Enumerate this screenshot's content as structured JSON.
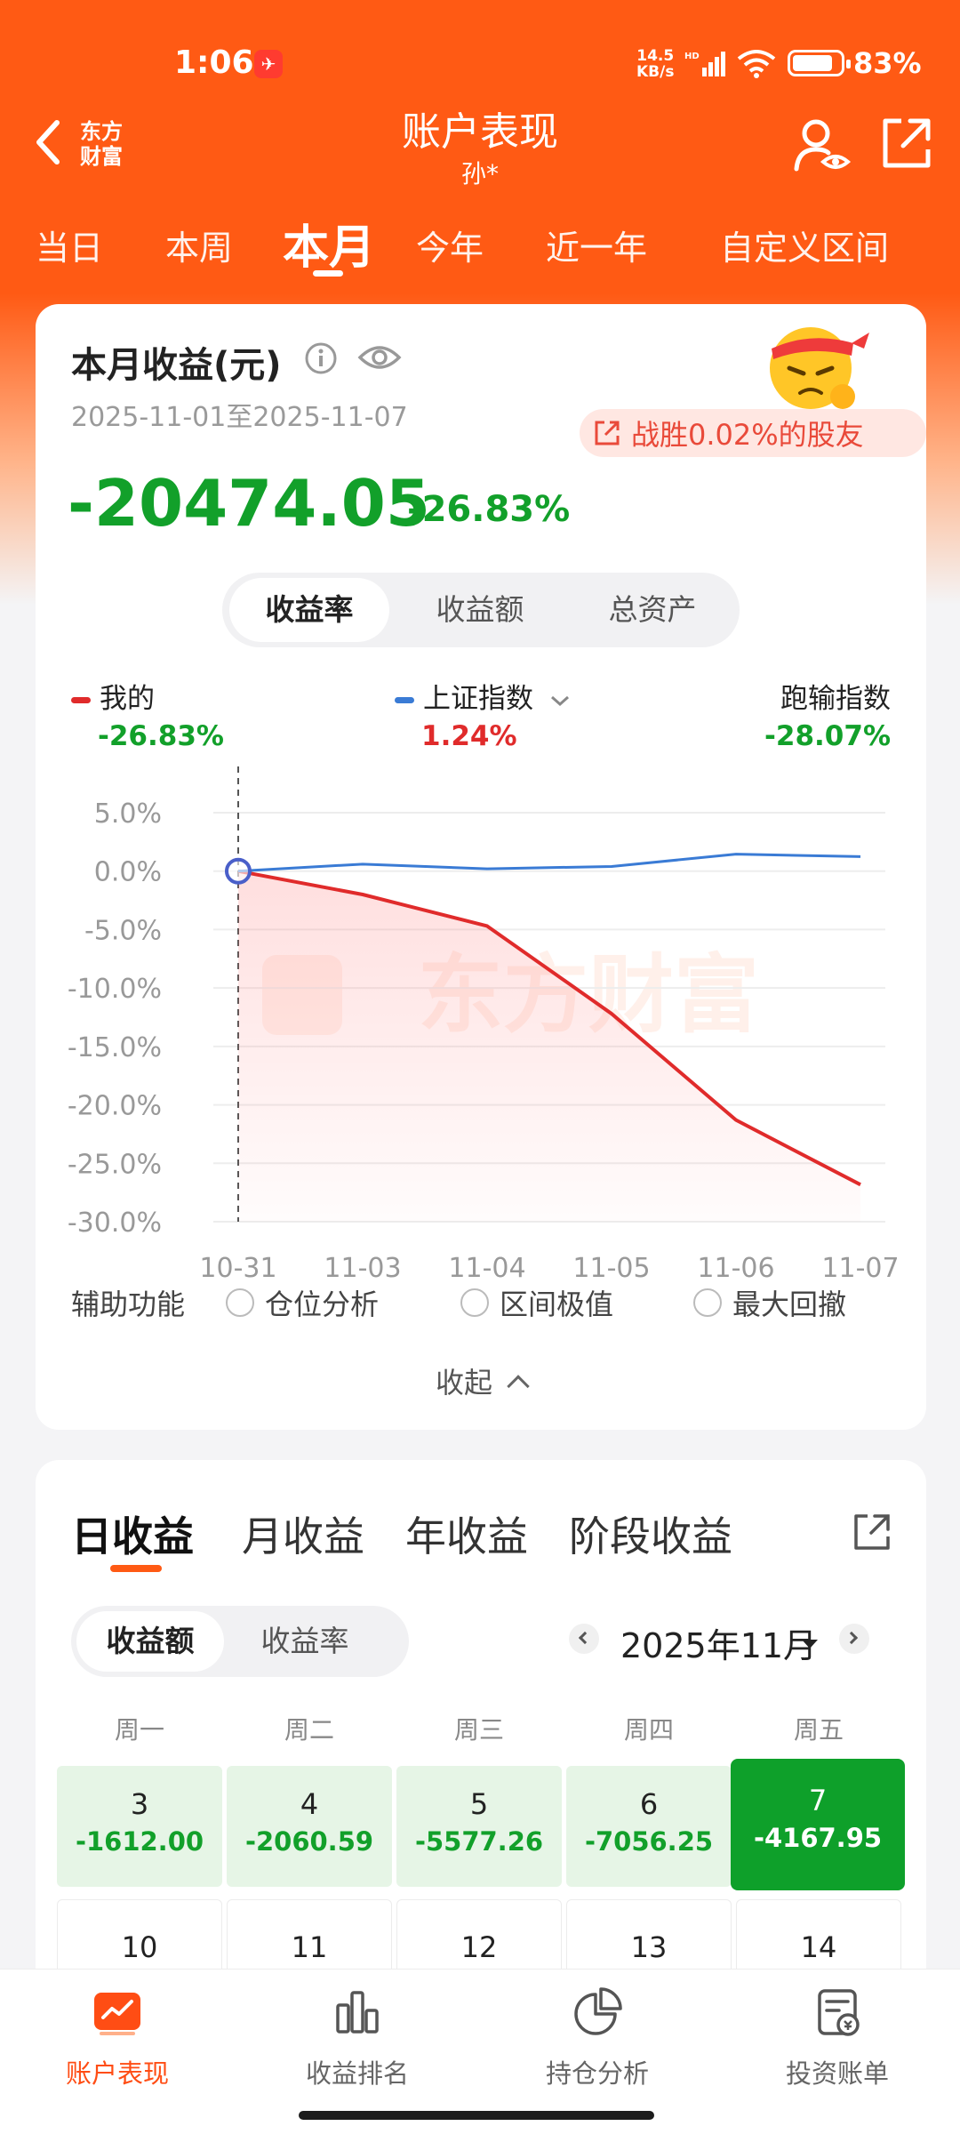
{
  "status_bar": {
    "time": "1:06",
    "net_speed_top": "14.5",
    "net_speed_bottom": "KB/s",
    "net_type": "HD",
    "battery": "83%"
  },
  "header": {
    "back_logo": "东方\n财富",
    "logo_line1": "东方",
    "logo_line2": "财富",
    "title": "账户表现",
    "subtitle": "孙*"
  },
  "period_tabs": [
    {
      "label": "当日"
    },
    {
      "label": "本周"
    },
    {
      "label": "本月",
      "active": true
    },
    {
      "label": "今年"
    },
    {
      "label": "近一年"
    },
    {
      "label": "自定义区间"
    }
  ],
  "summary": {
    "title": "本月收益(元)",
    "date_range": "2025-11-01至2025-11-07",
    "beat_text": "战胜0.02%的股友",
    "amount": "-20474.05",
    "percent": "-26.83%",
    "segments": [
      "收益率",
      "收益额",
      "总资产"
    ],
    "active_segment": "收益率"
  },
  "legend": {
    "mine": {
      "name": "我的",
      "value": "-26.83%",
      "color": "#e02b2b"
    },
    "index": {
      "name": "上证指数",
      "value": "1.24%",
      "color": "#3a7bd5"
    },
    "loser": {
      "name": "跑输指数",
      "value": "-28.07%"
    }
  },
  "colors": {
    "brand": "#ff5a14",
    "loss": "#12a02a",
    "gain": "#e02b2b"
  },
  "chart_data": {
    "type": "line",
    "x": [
      "10-31",
      "11-03",
      "11-04",
      "11-05",
      "11-06",
      "11-07"
    ],
    "yticks": [
      "5.0%",
      "0.0%",
      "-5.0%",
      "-10.0%",
      "-15.0%",
      "-20.0%",
      "-25.0%",
      "-30.0%"
    ],
    "ylim": [
      -30,
      5
    ],
    "series": [
      {
        "name": "我的",
        "values": [
          0,
          -2.0,
          -4.7,
          -12.2,
          -21.3,
          -26.83
        ]
      },
      {
        "name": "上证指数",
        "values": [
          0,
          0.6,
          0.2,
          0.4,
          1.45,
          1.24
        ]
      }
    ],
    "watermark": "东方财富"
  },
  "aux": {
    "label": "辅助功能",
    "options": [
      "仓位分析",
      "区间极值",
      "最大回撤"
    ],
    "collapse": "收起"
  },
  "profit_tabs": [
    {
      "label": "日收益",
      "active": true
    },
    {
      "label": "月收益"
    },
    {
      "label": "年收益"
    },
    {
      "label": "阶段收益"
    }
  ],
  "calendar": {
    "segments": [
      "收益额",
      "收益率"
    ],
    "month": "2025年11月",
    "weekdays": [
      "周一",
      "周二",
      "周三",
      "周四",
      "周五"
    ],
    "row1": [
      {
        "day": "3",
        "value": "-1612.00"
      },
      {
        "day": "4",
        "value": "-2060.59"
      },
      {
        "day": "5",
        "value": "-5577.26"
      },
      {
        "day": "6",
        "value": "-7056.25"
      },
      {
        "day": "7",
        "value": "-4167.95",
        "selected": true
      }
    ],
    "row2": [
      {
        "day": "10"
      },
      {
        "day": "11"
      },
      {
        "day": "12"
      },
      {
        "day": "13"
      },
      {
        "day": "14"
      }
    ]
  },
  "bottom_nav": [
    {
      "label": "账户表现",
      "icon": "trend-icon",
      "active": true
    },
    {
      "label": "收益排名",
      "icon": "bar-chart-icon"
    },
    {
      "label": "持仓分析",
      "icon": "pie-chart-icon"
    },
    {
      "label": "投资账单",
      "icon": "bill-icon"
    }
  ]
}
